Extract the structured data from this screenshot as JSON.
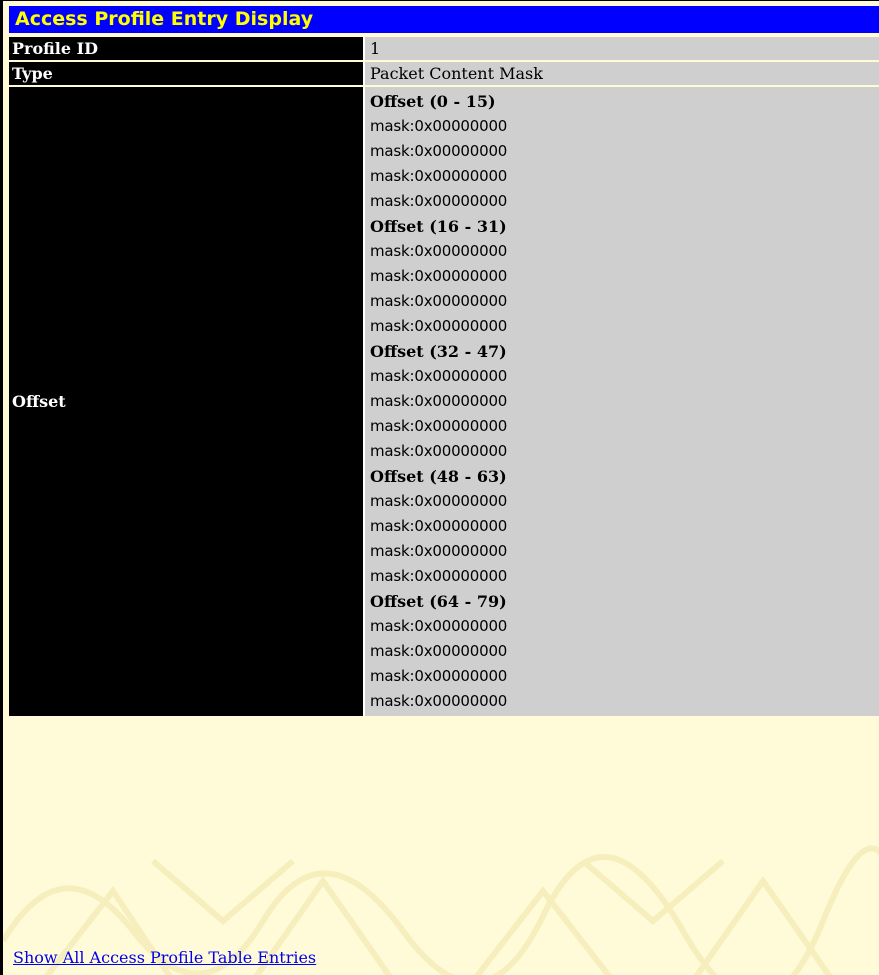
{
  "title": "Access Profile Entry Display",
  "rows": {
    "profile_id": {
      "label": "Profile ID",
      "value": "1"
    },
    "type": {
      "label": "Type",
      "value": "Packet Content Mask"
    },
    "offset": {
      "label": "Offset"
    }
  },
  "offset_groups": [
    {
      "title": "Offset (0 - 15)",
      "masks": [
        "mask:0x00000000",
        "mask:0x00000000",
        "mask:0x00000000",
        "mask:0x00000000"
      ]
    },
    {
      "title": "Offset (16 - 31)",
      "masks": [
        "mask:0x00000000",
        "mask:0x00000000",
        "mask:0x00000000",
        "mask:0x00000000"
      ]
    },
    {
      "title": "Offset (32 - 47)",
      "masks": [
        "mask:0x00000000",
        "mask:0x00000000",
        "mask:0x00000000",
        "mask:0x00000000"
      ]
    },
    {
      "title": "Offset (48 - 63)",
      "masks": [
        "mask:0x00000000",
        "mask:0x00000000",
        "mask:0x00000000",
        "mask:0x00000000"
      ]
    },
    {
      "title": "Offset (64 - 79)",
      "masks": [
        "mask:0x00000000",
        "mask:0x00000000",
        "mask:0x00000000",
        "mask:0x00000000"
      ]
    }
  ],
  "link_text": "Show All Access Profile Table Entries",
  "colors": {
    "title_bg": "#0000ff",
    "title_text": "#ffff00",
    "label_bg": "#000000",
    "value_bg": "#cfcfcf",
    "page_bg": "#fffbd8",
    "link": "#0000ee"
  }
}
